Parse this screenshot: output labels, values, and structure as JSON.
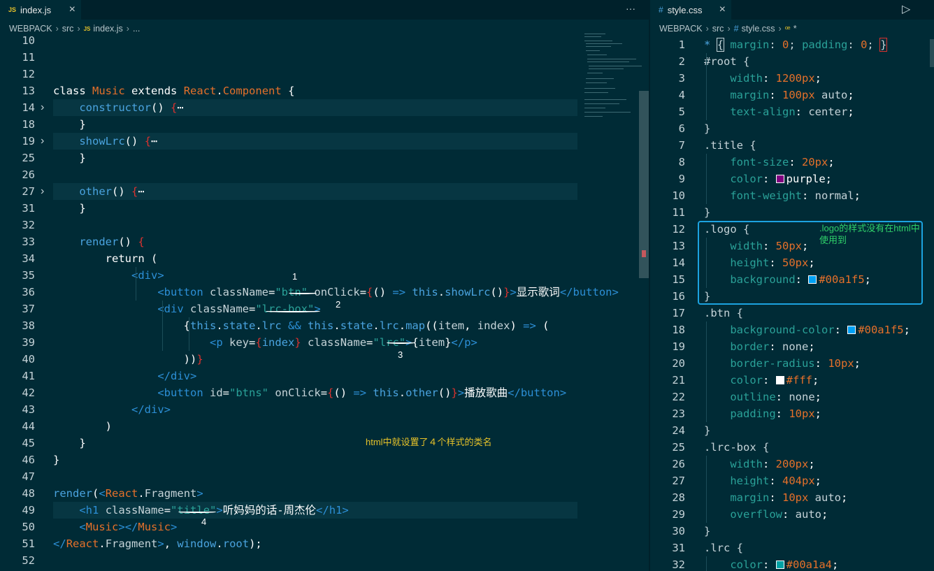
{
  "editor_left": {
    "tab": {
      "icon": "JS",
      "label": "index.js"
    },
    "tab_actions": "···",
    "breadcrumb": [
      "WEBPACK",
      "src",
      "index.js",
      "..."
    ],
    "breadcrumb_file_icon": "JS",
    "lines": [
      {
        "n": "10",
        "t": ""
      },
      {
        "n": "11",
        "t": ""
      },
      {
        "n": "12",
        "t": ""
      },
      {
        "n": "13",
        "t": "class Music extends React.Component {"
      },
      {
        "n": "14",
        "t": "    constructor() {⋯",
        "fold": true
      },
      {
        "n": "18",
        "t": "    }"
      },
      {
        "n": "19",
        "t": "    showLrc() {⋯",
        "fold": true
      },
      {
        "n": "25",
        "t": "    }"
      },
      {
        "n": "26",
        "t": ""
      },
      {
        "n": "27",
        "t": "    other() {⋯",
        "fold": true
      },
      {
        "n": "31",
        "t": "    }"
      },
      {
        "n": "32",
        "t": ""
      },
      {
        "n": "33",
        "t": "    render() {"
      },
      {
        "n": "34",
        "t": "        return ("
      },
      {
        "n": "35",
        "t": "            <div>"
      },
      {
        "n": "36",
        "t": "                <button className=\"btn\" onClick={() => this.showLrc()}>显示歌词</button>"
      },
      {
        "n": "37",
        "t": "                <div className=\"lrc-box\">"
      },
      {
        "n": "38",
        "t": "                    {this.state.lrc && this.state.lrc.map((item, index) => ("
      },
      {
        "n": "39",
        "t": "                        <p key={index} className=\"lrc\">{item}</p>"
      },
      {
        "n": "40",
        "t": "                    ))}"
      },
      {
        "n": "41",
        "t": "                </div>"
      },
      {
        "n": "42",
        "t": "                <button id=\"btns\" onClick={() => this.other()}>播放歌曲</button>"
      },
      {
        "n": "43",
        "t": "            </div>"
      },
      {
        "n": "44",
        "t": "        )"
      },
      {
        "n": "45",
        "t": "    }"
      },
      {
        "n": "46",
        "t": "}"
      },
      {
        "n": "47",
        "t": ""
      },
      {
        "n": "48",
        "t": "render(<React.Fragment>"
      },
      {
        "n": "49",
        "t": "    <h1 className=\"title\">听妈妈的话-周杰伦</h1>"
      },
      {
        "n": "50",
        "t": "    <Music></Music>"
      },
      {
        "n": "51",
        "t": "</React.Fragment>, window.root);"
      },
      {
        "n": "52",
        "t": ""
      },
      {
        "n": "53",
        "t": ""
      }
    ],
    "annotations": {
      "mark1": "1",
      "mark2": "2",
      "mark3": "3",
      "mark4": "4",
      "note": "html中就设置了４个样式的类名"
    }
  },
  "editor_right": {
    "tab": {
      "icon": "#",
      "label": "style.css"
    },
    "breadcrumb": [
      "WEBPACK",
      "src",
      "style.css",
      "*"
    ],
    "breadcrumb_file_icon": "#",
    "breadcrumb_symbol_icon": "ꟹ",
    "run_icon": "▷",
    "lines": [
      {
        "n": "1",
        "t": "* { margin: 0; padding: 0; }"
      },
      {
        "n": "2",
        "t": "#root {"
      },
      {
        "n": "3",
        "t": "    width: 1200px;"
      },
      {
        "n": "4",
        "t": "    margin: 100px auto;"
      },
      {
        "n": "5",
        "t": "    text-align: center;"
      },
      {
        "n": "6",
        "t": "}"
      },
      {
        "n": "7",
        "t": ".title {"
      },
      {
        "n": "8",
        "t": "    font-size: 20px;"
      },
      {
        "n": "9",
        "t": "    color: purple;"
      },
      {
        "n": "10",
        "t": "    font-weight: normal;"
      },
      {
        "n": "11",
        "t": "}"
      },
      {
        "n": "12",
        "t": ".logo {"
      },
      {
        "n": "13",
        "t": "    width: 50px;"
      },
      {
        "n": "14",
        "t": "    height: 50px;"
      },
      {
        "n": "15",
        "t": "    background: #00a1f5;"
      },
      {
        "n": "16",
        "t": "}"
      },
      {
        "n": "17",
        "t": ".btn {"
      },
      {
        "n": "18",
        "t": "    background-color: #00a1f5;"
      },
      {
        "n": "19",
        "t": "    border: none;"
      },
      {
        "n": "20",
        "t": "    border-radius: 10px;"
      },
      {
        "n": "21",
        "t": "    color: #fff;"
      },
      {
        "n": "22",
        "t": "    outline: none;"
      },
      {
        "n": "23",
        "t": "    padding: 10px;"
      },
      {
        "n": "24",
        "t": "}"
      },
      {
        "n": "25",
        "t": ".lrc-box {"
      },
      {
        "n": "26",
        "t": "    width: 200px;"
      },
      {
        "n": "27",
        "t": "    height: 404px;"
      },
      {
        "n": "28",
        "t": "    margin: 10px auto;"
      },
      {
        "n": "29",
        "t": "    overflow: auto;"
      },
      {
        "n": "30",
        "t": "}"
      },
      {
        "n": "31",
        "t": ".lrc {"
      },
      {
        "n": "32",
        "t": "    color: #00a1a4;"
      }
    ],
    "box_note": ".logo的样式没有在html中使用到",
    "colors": {
      "purple": "#800080",
      "blue": "#00a1f5",
      "white": "#ffffff",
      "teal": "#00a1a4"
    }
  }
}
